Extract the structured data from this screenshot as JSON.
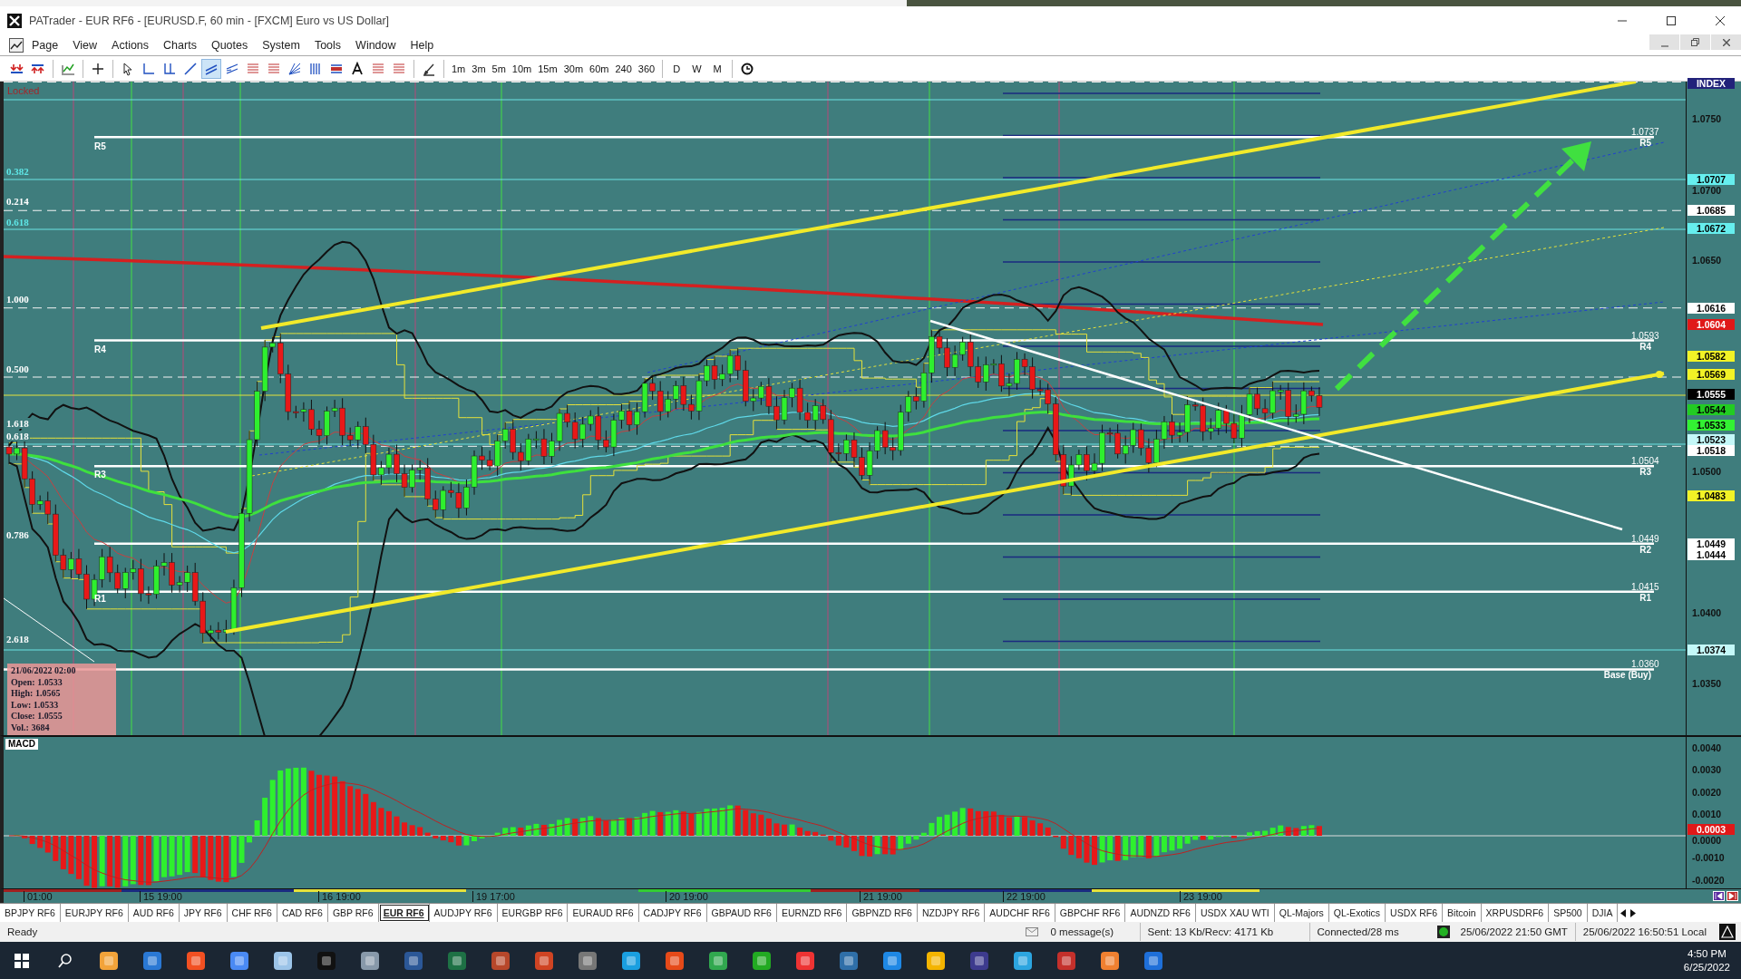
{
  "window": {
    "title": "PATrader - EUR RF6 - [EURUSD.F, 60 min - [FXCM] Euro vs US Dollar]"
  },
  "menu": [
    "Page",
    "View",
    "Actions",
    "Charts",
    "Quotes",
    "System",
    "Tools",
    "Window",
    "Help"
  ],
  "toolbar": {
    "tools": [
      {
        "kind": "arrows-down",
        "selected": false
      },
      {
        "kind": "arrows-up",
        "selected": false
      },
      {
        "kind": "bar-chart",
        "selected": false
      },
      {
        "kind": "crosshair",
        "selected": false
      },
      {
        "kind": "pointer",
        "selected": false
      },
      {
        "kind": "hline",
        "selected": false
      },
      {
        "kind": "vlines",
        "selected": false
      },
      {
        "kind": "trendline",
        "selected": false
      },
      {
        "kind": "channel",
        "selected": true
      },
      {
        "kind": "regression",
        "selected": false
      },
      {
        "kind": "levels",
        "selected": false
      },
      {
        "kind": "levels",
        "selected": false
      },
      {
        "kind": "fan",
        "selected": false
      },
      {
        "kind": "vbars",
        "selected": false
      },
      {
        "kind": "band",
        "selected": false
      },
      {
        "kind": "text",
        "selected": false
      },
      {
        "kind": "levels",
        "selected": false
      },
      {
        "kind": "levels",
        "selected": false
      },
      {
        "kind": "pen",
        "selected": false
      }
    ],
    "timeframes": [
      "1m",
      "3m",
      "5m",
      "10m",
      "15m",
      "30m",
      "60m",
      "240",
      "360"
    ],
    "periods": [
      "D",
      "W",
      "M"
    ]
  },
  "chart": {
    "lock_label": "Locked",
    "fib_labels": [
      {
        "text": "0.382",
        "color": "#5fe8e8"
      },
      {
        "text": "0.214",
        "color": "#ffffff"
      },
      {
        "text": "0.618",
        "color": "#5fe8e8"
      },
      {
        "text": "1.000",
        "color": "#ffffff"
      },
      {
        "text": "0.500",
        "color": "#ffffff"
      },
      {
        "text": "1.618",
        "color": "#ffffff"
      },
      {
        "text": "0.618",
        "color": "#ffffff"
      },
      {
        "text": "0.786",
        "color": "#ffffff"
      },
      {
        "text": "2.618",
        "color": "#ffffff"
      }
    ],
    "pivot_left": [
      "R5",
      "R4",
      "R3",
      "R1"
    ],
    "pivot_right": [
      {
        "price": "1.0737",
        "name": "R5"
      },
      {
        "price": "1.0593",
        "name": "R4"
      },
      {
        "price": "1.0504",
        "name": "R3"
      },
      {
        "price": "1.0449",
        "name": "R2"
      },
      {
        "price": "1.0415",
        "name": "R1"
      },
      {
        "price": "1.0360",
        "name": "Base (Buy)"
      }
    ],
    "info": {
      "title": "21/06/2022 02:00",
      "lines": [
        "Open: 1.0533",
        "High: 1.0565",
        "Low: 1.0533",
        "Close: 1.0555",
        "Vol.: 3684"
      ]
    },
    "price_ticks": [
      "1.0750",
      "1.0700",
      "1.0650",
      "1.0500",
      "1.0400",
      "1.0350"
    ],
    "price_tags": [
      {
        "text": "INDEX",
        "color": "#22227a"
      },
      {
        "text": "1.0707",
        "color": "#66eeee"
      },
      {
        "text": "1.0685",
        "color": "#ffffff"
      },
      {
        "text": "1.0672",
        "color": "#66eeee"
      },
      {
        "text": "1.0616",
        "color": "#ffffff"
      },
      {
        "text": "1.0604",
        "color": "#e01818"
      },
      {
        "text": "1.0582",
        "color": "#f2f226"
      },
      {
        "text": "1.0569",
        "color": "#f2f226"
      },
      {
        "text": "1.0555",
        "color": "#000000"
      },
      {
        "text": "1.0544",
        "color": "#22cc22"
      },
      {
        "text": "1.0533",
        "color": "#33f033"
      },
      {
        "text": "1.0523",
        "color": "#c4f8f8"
      },
      {
        "text": "1.0518",
        "color": "#ffffff"
      },
      {
        "text": "1.0483",
        "color": "#f2f226"
      },
      {
        "text": "1.0449",
        "color": "#ffffff"
      },
      {
        "text": "1.0444",
        "color": "#ffffff"
      },
      {
        "text": "1.0374",
        "color": "#c4f8f8"
      }
    ]
  },
  "macd": {
    "label": "MACD",
    "ticks": [
      "0.0040",
      "0.0030",
      "0.0020",
      "0.0010",
      "0.0000",
      "-0.0010",
      "-0.0020"
    ],
    "tags": [
      {
        "text": "0.0003",
        "color": "#e01818"
      }
    ]
  },
  "time_axis": [
    "01:00",
    "15 19:00",
    "16 19:00",
    "19 17:00",
    "20 19:00",
    "21 19:00",
    "22 19:00",
    "23 19:00"
  ],
  "tabs": [
    {
      "label": "BPJPY RF6",
      "selected": false
    },
    {
      "label": "EURJPY RF6",
      "selected": false
    },
    {
      "label": "AUD RF6",
      "selected": false
    },
    {
      "label": "JPY RF6",
      "selected": false
    },
    {
      "label": "CHF RF6",
      "selected": false
    },
    {
      "label": "CAD RF6",
      "selected": false
    },
    {
      "label": "GBP RF6",
      "selected": false
    },
    {
      "label": "EUR RF6",
      "selected": true
    },
    {
      "label": "AUDJPY RF6",
      "selected": false
    },
    {
      "label": "EURGBP RF6",
      "selected": false
    },
    {
      "label": "EURAUD RF6",
      "selected": false
    },
    {
      "label": "CADJPY RF6",
      "selected": false
    },
    {
      "label": "GBPAUD RF6",
      "selected": false
    },
    {
      "label": "EURNZD RF6",
      "selected": false
    },
    {
      "label": "GBPNZD RF6",
      "selected": false
    },
    {
      "label": "NZDJPY RF6",
      "selected": false
    },
    {
      "label": "AUDCHF RF6",
      "selected": false
    },
    {
      "label": "GBPCHF RF6",
      "selected": false
    },
    {
      "label": "AUDNZD RF6",
      "selected": false
    },
    {
      "label": "USDX XAU WTI",
      "selected": false
    },
    {
      "label": "QL-Majors",
      "selected": false
    },
    {
      "label": "QL-Exotics",
      "selected": false
    },
    {
      "label": "USDX RF6",
      "selected": false
    },
    {
      "label": "Bitcoin",
      "selected": false
    },
    {
      "label": "XRPUSDRF6",
      "selected": false
    },
    {
      "label": "SP500",
      "selected": false
    },
    {
      "label": "DJIA",
      "selected": false
    }
  ],
  "status_bar": {
    "ready": "Ready",
    "messages": "0 message(s)",
    "traffic": "Sent: 13 Kb/Recv: 4171 Kb",
    "connection": "Connected/28 ms",
    "gmt": "25/06/2022 21:50 GMT",
    "local": "25/06/2022 16:50:51 Local"
  },
  "taskbar": {
    "time": "4:50 PM",
    "date": "6/25/2022"
  }
}
